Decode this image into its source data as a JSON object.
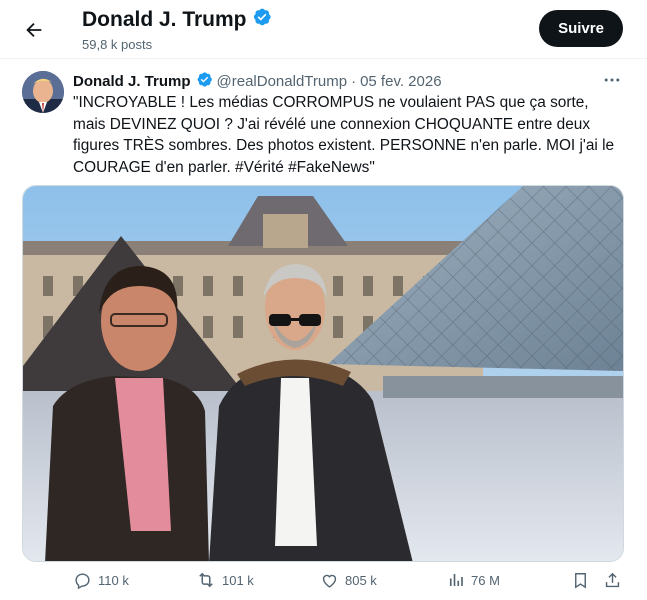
{
  "header": {
    "name": "Donald J. Trump",
    "posts_count": "59,8 k posts",
    "follow_label": "Suivre",
    "back_icon": "arrow-left-icon",
    "verified_icon": "verified-badge-icon"
  },
  "post": {
    "author_name": "Donald J. Trump",
    "author_handle": "@realDonaldTrump",
    "separator": "·",
    "date": "05 fev. 2026",
    "more_icon": "more-horizontal-icon",
    "text": "\"INCROYABLE ! Les médias CORROMPUS ne voulaient PAS que ça sorte, mais DEVINEZ QUOI ? J'ai révélé une connexion CHOQUANTE  entre deux figures TRÈS sombres. Des photos existent. PERSONNE n'en parle. MOI j'ai le COURAGE d'en parler. #Vérité #FakeNews\"",
    "image_alt": "Two men posing in front of the Louvre pyramid"
  },
  "actions": {
    "replies": "110 k",
    "reposts": "101 k",
    "likes": "805 k",
    "views": "76 M",
    "reply_icon": "reply-icon",
    "repost_icon": "repost-icon",
    "like_icon": "heart-icon",
    "views_icon": "views-chart-icon",
    "bookmark_icon": "bookmark-icon",
    "share_icon": "share-icon"
  },
  "colors": {
    "text_primary": "#0f1419",
    "text_secondary": "#536471",
    "verified_blue": "#1d9bf0",
    "button_dark": "#0f1419"
  }
}
